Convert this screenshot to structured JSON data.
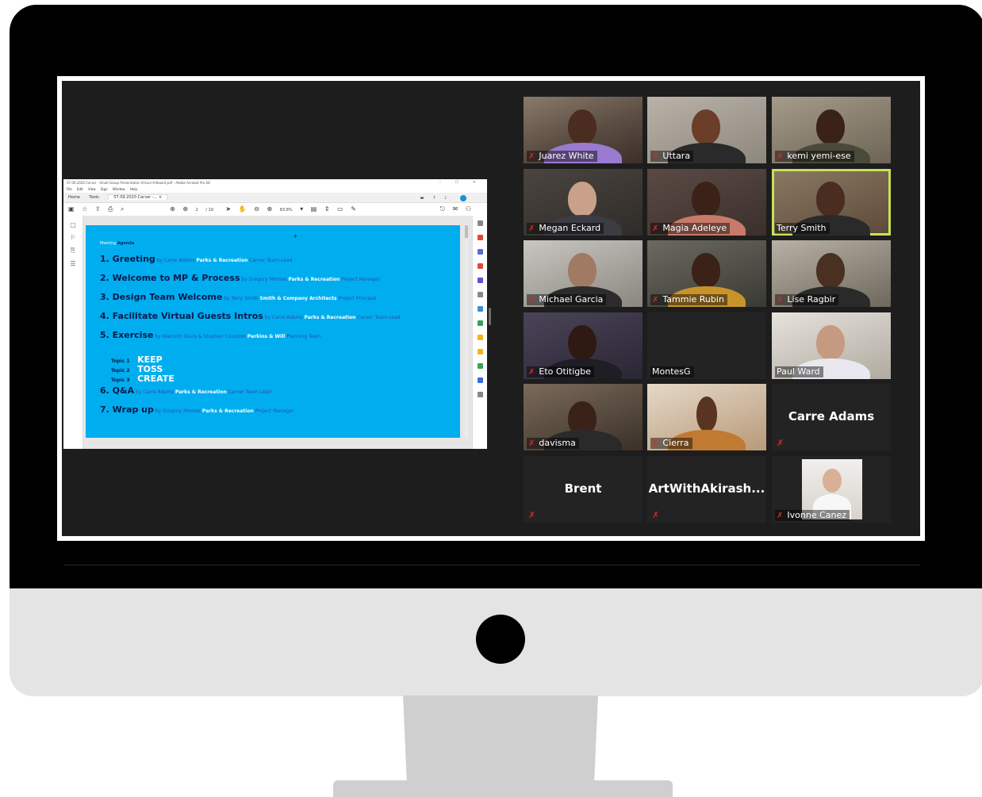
{
  "acrobat": {
    "window_title": "07.09.2020 Carver - Small Group Presentation Virtual Artboard.pdf - Adobe Acrobat Pro DC",
    "window_controls": "– ☐ ✕",
    "menu": [
      "File",
      "Edit",
      "View",
      "Sign",
      "Window",
      "Help"
    ],
    "tabs": {
      "home": "Home",
      "tools": "Tools",
      "document": "07.09.2020 Carver -...  ×"
    },
    "toolbar": {
      "page_current": "2",
      "page_total": "/ 19",
      "zoom": "83.8%"
    }
  },
  "slide": {
    "title_prefix": "Meeting",
    "title_bold": "Agenda",
    "items": [
      {
        "heading": "1. Greeting",
        "by": "by Carre Adams",
        "org": "Parks & Recreation",
        "role": "Carver Team Lead"
      },
      {
        "heading": "2. Welcome to MP & Process",
        "by": "by Gregory Montes",
        "org": "Parks & Recreation",
        "role": "Project Manager"
      },
      {
        "heading": "3. Design Team Welcome",
        "by": "by Terry Smith",
        "org": "Smith & Company Architects",
        "role": "Project Principal"
      },
      {
        "heading": "4. Facilitate Virtual Guests Intros",
        "by": "by Carre Adams",
        "org": "Parks & Recreation",
        "role": "Carver Team Lead"
      },
      {
        "heading": "5. Exercise",
        "by": "by Malcolm Davis & Stephen Coulston",
        "org": "Perkins & Will",
        "role": "Planning Team"
      },
      {
        "heading": "6. Q&A",
        "by": "by Carre Adams",
        "org": "Parks & Recreation",
        "role": "Carver Team Lead"
      },
      {
        "heading": "7. Wrap up",
        "by": "by Gregory Montes",
        "org": "Parks & Recreation",
        "role": "Project Manager"
      }
    ],
    "topics": [
      {
        "label": "Topic 1",
        "word": "KEEP"
      },
      {
        "label": "Topic 2",
        "word": "TOSS"
      },
      {
        "label": "Topic 3",
        "word": "CREATE"
      }
    ]
  },
  "participants": [
    {
      "name": "Juarez White"
    },
    {
      "name": "Uttara"
    },
    {
      "name": "kemi yemi-ese"
    },
    {
      "name": "Megan Eckard"
    },
    {
      "name": "Magia Adeleye"
    },
    {
      "name": "Terry Smith"
    },
    {
      "name": "Michael Garcia"
    },
    {
      "name": "Tammie Rubin"
    },
    {
      "name": "Lise Ragbir"
    },
    {
      "name": "Eto Otitigbe"
    },
    {
      "name": "MontesG"
    },
    {
      "name": "Paul Ward"
    },
    {
      "name": "davisma"
    },
    {
      "name": "Cierra"
    },
    {
      "name": "Carre Adams"
    },
    {
      "name": "Brent"
    },
    {
      "name": "ArtWithAkirash..."
    },
    {
      "name": "Ivonne Canez"
    }
  ],
  "icons": {
    "muted_mic": "✗"
  },
  "colors": {
    "active_speaker": "#c9df5a",
    "slide_bg": "#00aeef",
    "muted": "#e0242b"
  }
}
